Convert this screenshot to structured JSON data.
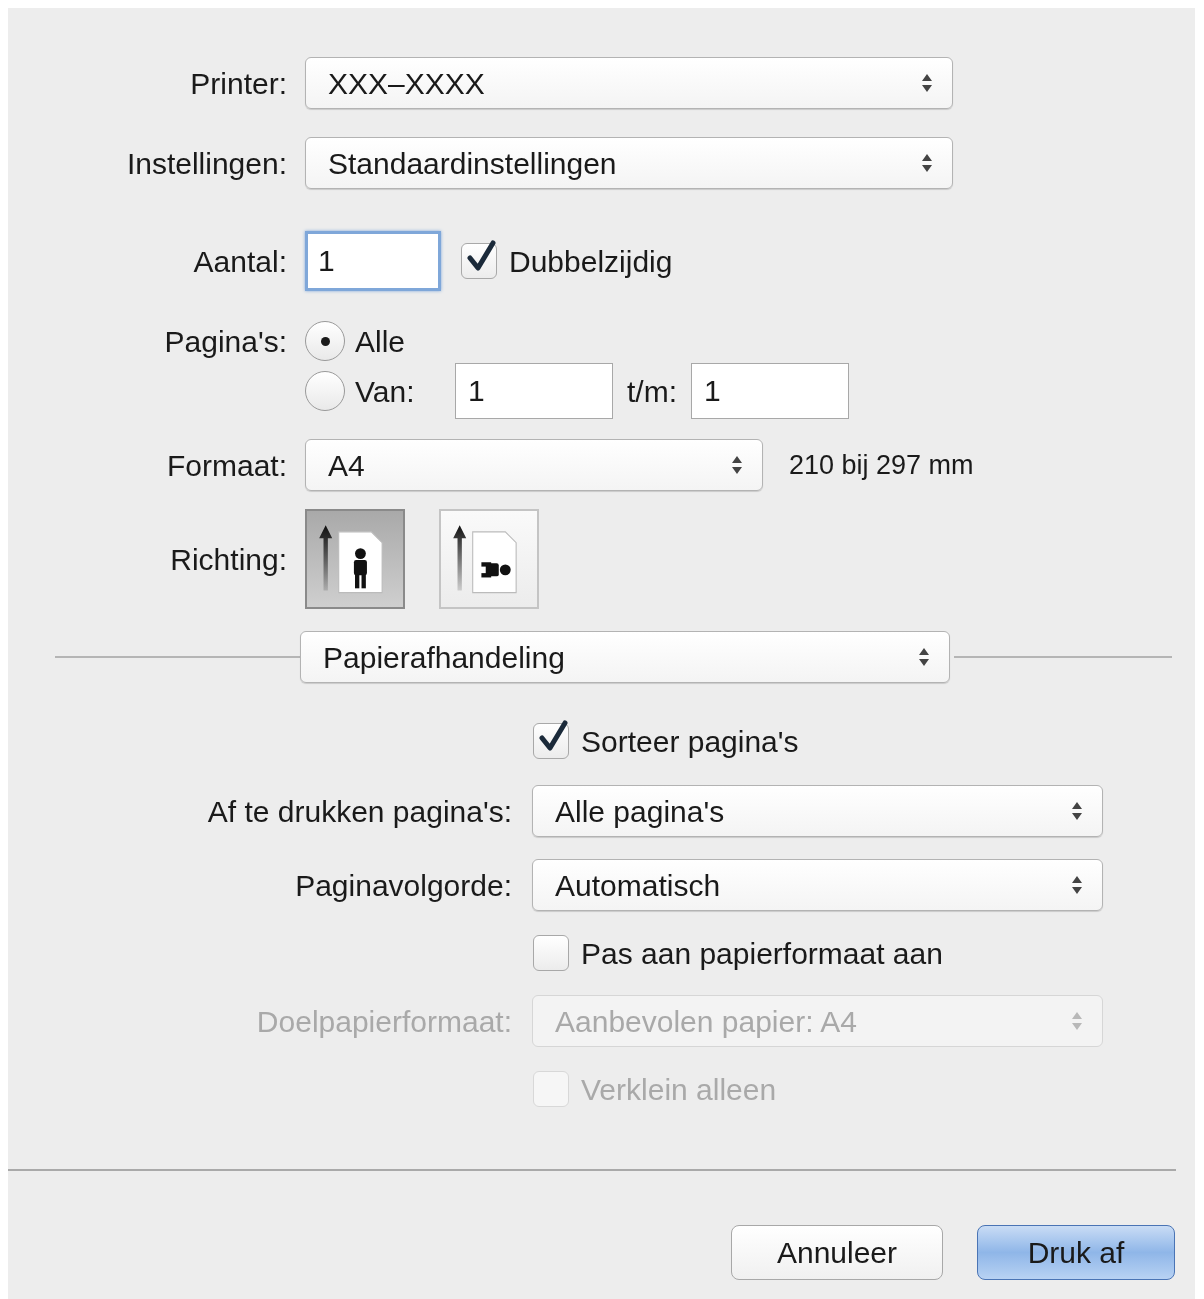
{
  "printer": {
    "label": "Printer:",
    "value": "XXX–XXXX"
  },
  "settings": {
    "label": "Instellingen:",
    "value": "Standaardinstellingen"
  },
  "copies": {
    "label": "Aantal:",
    "value": "1"
  },
  "two_sided": {
    "label": "Dubbelzijdig",
    "checked": true
  },
  "pages": {
    "label": "Pagina's:",
    "options": [
      {
        "label": "Alle",
        "selected": true
      },
      {
        "label": "Van:",
        "selected": false
      }
    ],
    "from_value": "1",
    "to_label": "t/m:",
    "to_value": "1"
  },
  "paper_size": {
    "label": "Formaat:",
    "value": "A4",
    "dimensions": "210 bij 297 mm"
  },
  "orientation": {
    "label": "Richting:",
    "options": [
      {
        "kind": "portrait",
        "selected": true
      },
      {
        "kind": "landscape",
        "selected": false
      }
    ]
  },
  "section": {
    "value": "Papierafhandeling"
  },
  "collate": {
    "label": "Sorteer pagina's",
    "checked": true,
    "disabled": false
  },
  "pages_to_print": {
    "label": "Af te drukken pagina's:",
    "value": "Alle pagina's",
    "disabled": false
  },
  "page_order": {
    "label": "Paginavolgorde:",
    "value": "Automatisch",
    "disabled": false
  },
  "scale_to_fit": {
    "label": "Pas aan papierformaat aan",
    "checked": false,
    "disabled": false
  },
  "destination_paper": {
    "label": "Doelpapierformaat:",
    "value": "Aanbevolen papier: A4",
    "disabled": true
  },
  "scale_down_only": {
    "label": "Verklein alleen",
    "checked": false,
    "disabled": true
  },
  "buttons": [
    {
      "label": "Annuleer",
      "kind": "cancel"
    },
    {
      "label": "Druk af",
      "kind": "default"
    }
  ]
}
